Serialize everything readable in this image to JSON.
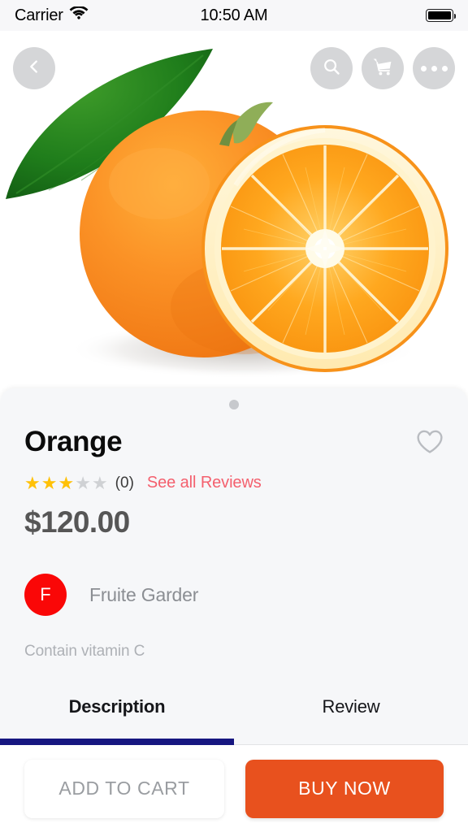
{
  "status_bar": {
    "carrier": "Carrier",
    "wifi_icon": "wifi-icon",
    "time": "10:50 AM",
    "battery_icon": "battery-full-icon"
  },
  "top_actions": {
    "back_icon": "chevron-left-icon",
    "search_icon": "search-icon",
    "cart_icon": "shopping-cart-icon",
    "more_icon": "more-horizontal-icon"
  },
  "gallery": {
    "image_alt": "orange-product-photo",
    "page_dots": 1,
    "active_dot": 1
  },
  "product": {
    "name": "Orange",
    "favorite_icon": "heart-outline-icon",
    "rating_value": 3,
    "rating_max": 5,
    "review_count_label": "(0)",
    "see_reviews_label": "See all Reviews",
    "price": "$120.00",
    "seller_initial": "F",
    "seller_name": "Fruite Garder",
    "description": "Contain vitamin C"
  },
  "tabs": [
    {
      "label": "Description",
      "active": true
    },
    {
      "label": "Review",
      "active": false
    }
  ],
  "footer": {
    "add_to_cart_label": "ADD TO CART",
    "buy_now_label": "BUY NOW"
  },
  "colors": {
    "accent_orange": "#e8511e",
    "star_gold": "#ffc107",
    "star_gray": "#cfd1d4",
    "review_link": "#f4606e",
    "avatar_red": "#fa0707",
    "tab_indicator": "#161680",
    "sheet_bg": "#f6f7f9"
  }
}
